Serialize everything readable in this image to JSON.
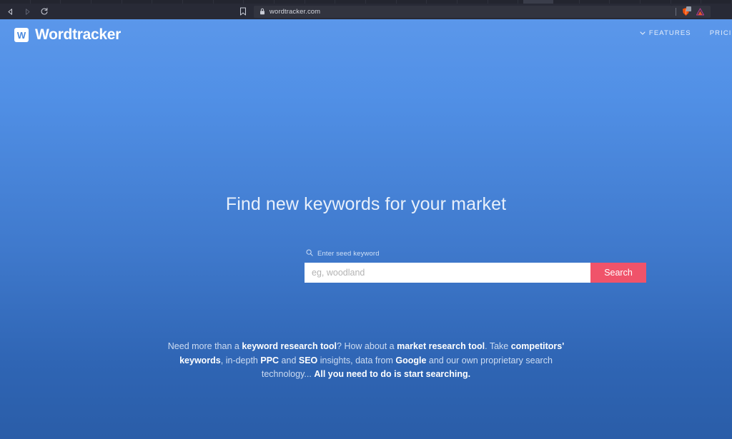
{
  "browser": {
    "back_icon": "back-arrow-icon",
    "forward_icon": "forward-arrow-icon",
    "reload_icon": "reload-icon",
    "bookmark_icon": "bookmark-icon",
    "lock_icon": "lock-icon",
    "url": "wordtracker.com",
    "extensions": [
      {
        "name": "brave-shields-icon",
        "badge": "1"
      },
      {
        "name": "triangle-extension-icon"
      }
    ]
  },
  "site": {
    "brand": {
      "mark_letter": "W",
      "name": "Wordtracker"
    },
    "nav": [
      {
        "label": "FEATURES",
        "icon": "chevron-down-icon"
      },
      {
        "label": "PRICING"
      }
    ]
  },
  "hero": {
    "headline": "Find new keywords for your market",
    "search": {
      "label": "Enter seed keyword",
      "label_icon": "search-icon",
      "value": "",
      "placeholder": "eg, woodland",
      "button_label": "Search"
    },
    "sub_copy": {
      "line1_a": "Need more than a ",
      "line1_b": "keyword research tool",
      "line1_c": "? How about a ",
      "line1_d": "market research tool",
      "line1_e": ". Take ",
      "line1_f": "competitors'",
      "line2_a": "keywords",
      "line2_b": ", in-depth ",
      "line2_c": "PPC",
      "line2_d": " and ",
      "line2_e": "SEO",
      "line2_f": " insights, data from ",
      "line2_g": "Google",
      "line2_h": " and our own proprietary search",
      "line3_a": "technology... ",
      "line3_b": "All you need to do is start searching."
    }
  },
  "colors": {
    "brand_blue_top": "#5b97ea",
    "brand_blue_bottom": "#2a5da8",
    "accent_red": "#f0536a",
    "chrome_bg": "#282a36"
  }
}
